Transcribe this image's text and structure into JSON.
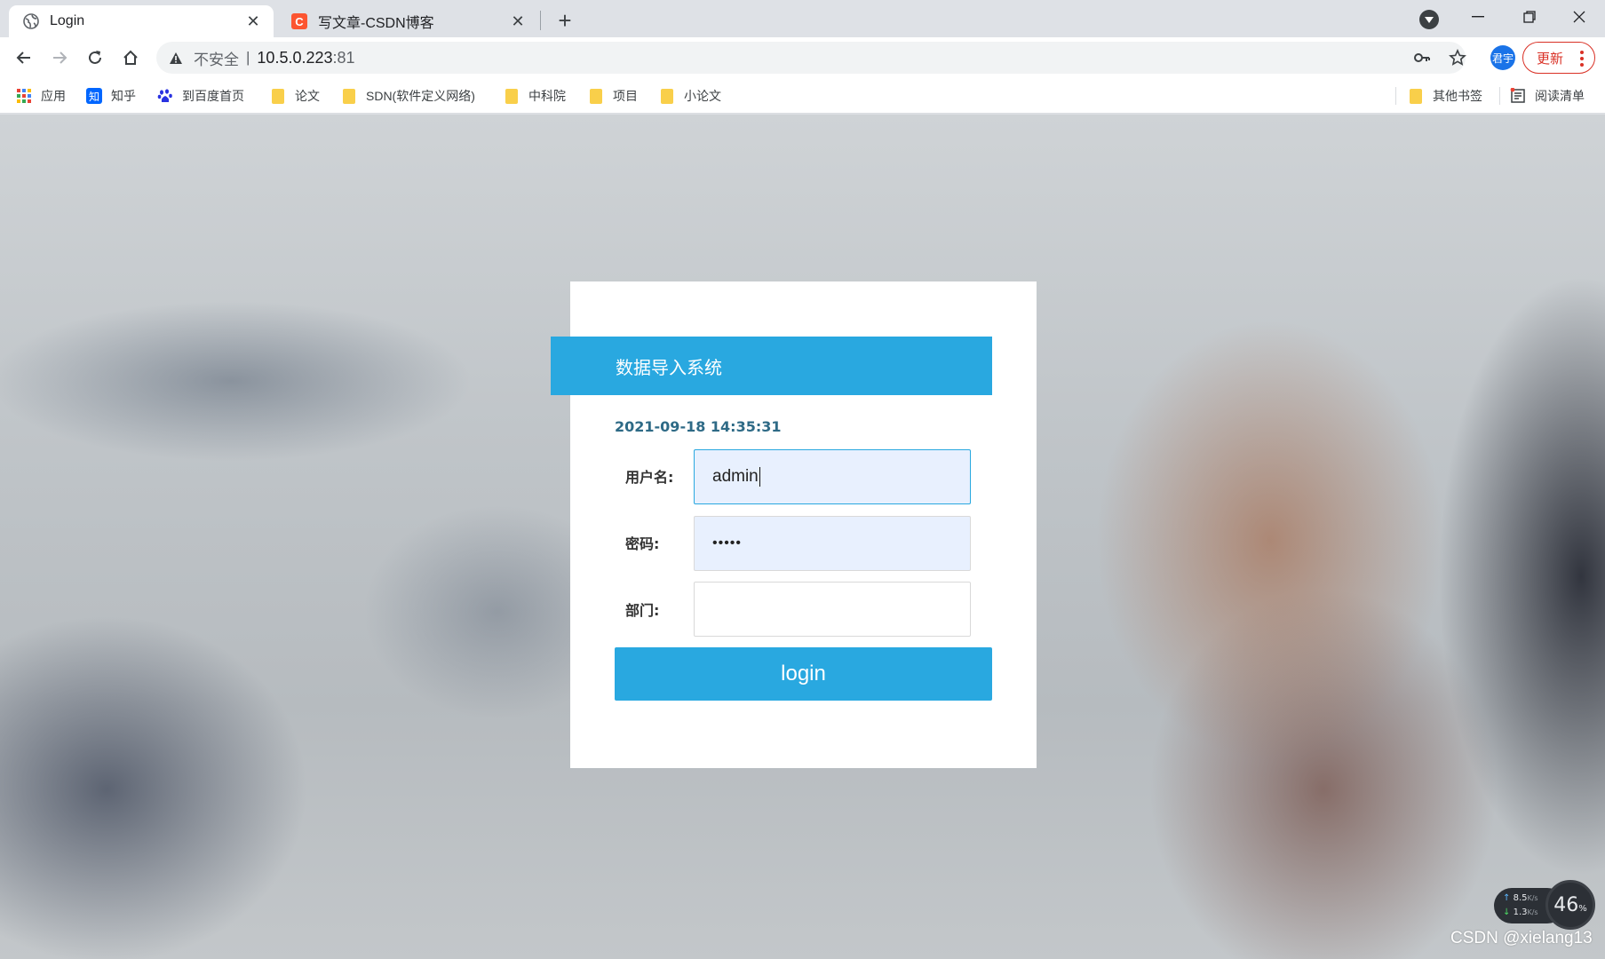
{
  "browser": {
    "tabs": [
      {
        "title": "Login",
        "icon": "globe-icon",
        "active": true
      },
      {
        "title": "写文章-CSDN博客",
        "icon": "csdn-icon",
        "active": false
      }
    ],
    "csdn_icon_letter": "C",
    "address": {
      "security_label": "不安全",
      "separator": "|",
      "host": "10.5.0.223",
      "port": ":81"
    },
    "profile_label": "君宇",
    "update_label": "更新",
    "bookmarks": [
      {
        "label": "应用",
        "icon": "apps-grid-icon"
      },
      {
        "label": "知乎",
        "icon": "zhihu-icon"
      },
      {
        "label": "到百度首页",
        "icon": "baidu-paw-icon"
      },
      {
        "label": "论文",
        "icon": "folder-icon"
      },
      {
        "label": "SDN(软件定义网络)",
        "icon": "folder-icon"
      },
      {
        "label": "中科院",
        "icon": "folder-icon"
      },
      {
        "label": "项目",
        "icon": "folder-icon"
      },
      {
        "label": "小论文",
        "icon": "folder-icon"
      }
    ],
    "zhihu_icon_letter": "知",
    "bookmarks_right": [
      {
        "label": "其他书签",
        "icon": "folder-icon"
      },
      {
        "label": "阅读清单",
        "icon": "reading-list-icon"
      }
    ]
  },
  "login": {
    "system_title": "数据导入系统",
    "datetime": "2021-09-18 14:35:31",
    "username_label": "用户名:",
    "username_value": "admin",
    "password_label": "密码:",
    "password_value": "•••••",
    "department_label": "部门:",
    "department_value": "",
    "login_button": "login"
  },
  "overlay": {
    "upload_speed": "8.5",
    "download_speed": "1.3",
    "speed_unit": "K/s",
    "usage_value": "46",
    "usage_unit": "%",
    "watermark": "CSDN @xielang13"
  },
  "colors": {
    "accent": "#29a8e0",
    "datetime_text": "#2e6a86",
    "update_red": "#d93025",
    "csdn_red": "#fc5531"
  }
}
